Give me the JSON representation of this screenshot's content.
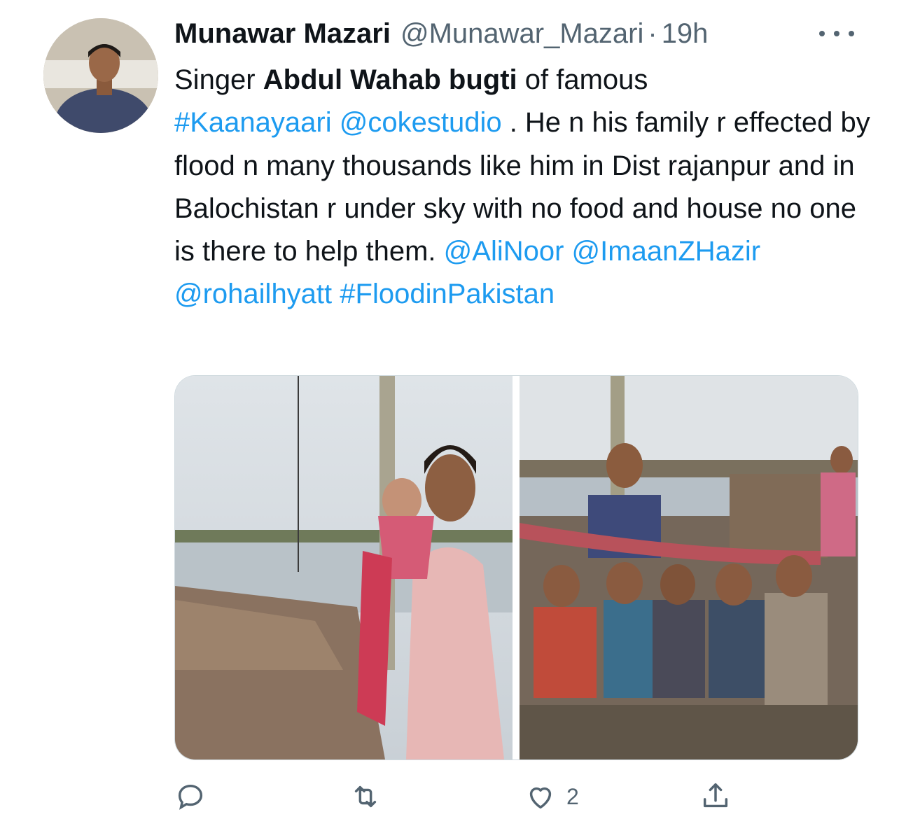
{
  "author": {
    "display_name": "Munawar Mazari",
    "handle": "@Munawar_Mazari",
    "separator": "·",
    "time": "19h"
  },
  "tweet": {
    "t1": "Singer ",
    "t2": "Abdul Wahab bugti",
    "t3": "  of famous",
    "hashtag1": "#Kaanayaari",
    "mention1": "@cokestudio",
    "t4": " . He n his family r effected by flood n many thousands like him in Dist rajanpur and in Balochistan r under sky with no food and house no one is there to help them. ",
    "mention2": "@AliNoor",
    "mention3": "@ImaanZHazir",
    "mention4": "@rohailhyatt",
    "hashtag2": "#FloodinPakistan"
  },
  "actions": {
    "reply_icon": "reply-icon",
    "retweet_icon": "retweet-icon",
    "like_icon": "heart-icon",
    "like_count": "2",
    "share_icon": "share-icon"
  },
  "colors": {
    "link": "#1d9bf0",
    "secondary": "#536471",
    "text": "#0f1419"
  }
}
